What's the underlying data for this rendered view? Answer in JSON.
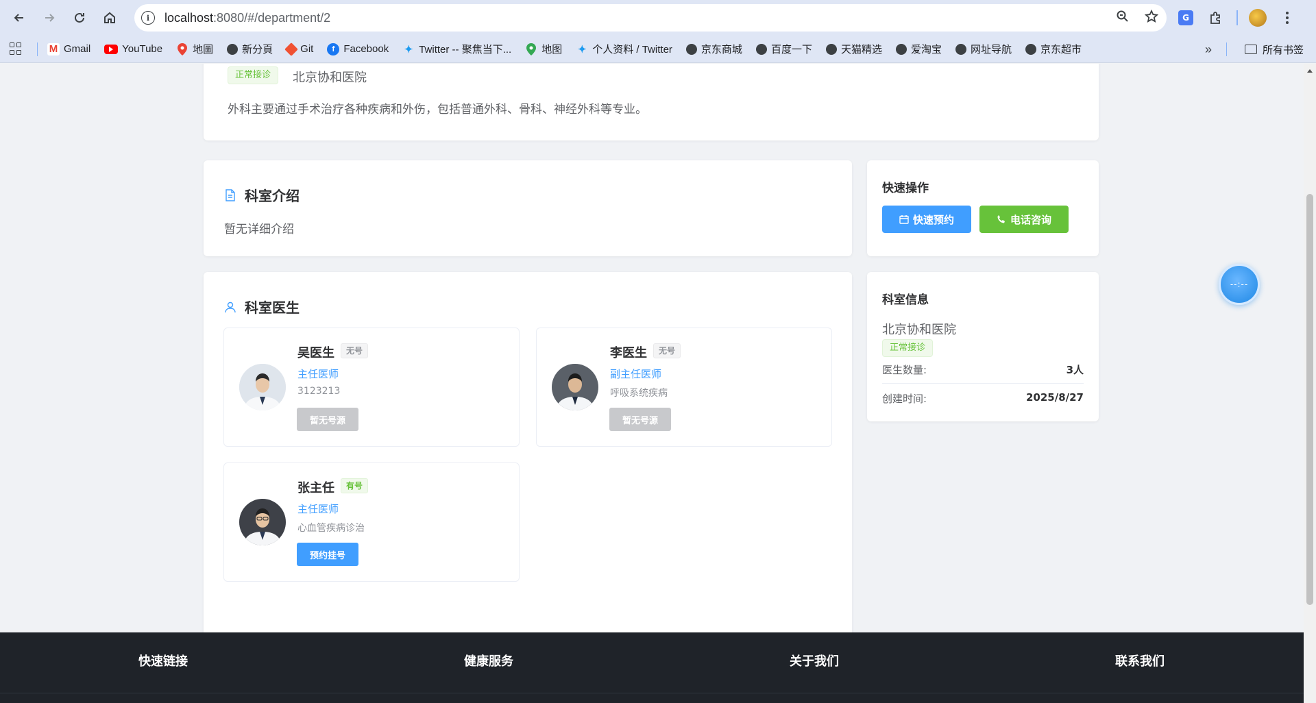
{
  "browser": {
    "url_host": "localhost",
    "url_rest": ":8080/#/department/2"
  },
  "bookmarks": [
    {
      "label": "Gmail",
      "icon": "gmail-icon"
    },
    {
      "label": "YouTube",
      "icon": "youtube-icon"
    },
    {
      "label": "地圖",
      "icon": "maps-icon"
    },
    {
      "label": "新分頁",
      "icon": "globe-icon"
    },
    {
      "label": "Git",
      "icon": "git-icon"
    },
    {
      "label": "Facebook",
      "icon": "facebook-icon"
    },
    {
      "label": "Twitter -- 聚焦当下...",
      "icon": "twitter-icon"
    },
    {
      "label": "地图",
      "icon": "maps-icon"
    },
    {
      "label": "个人资料 / Twitter",
      "icon": "twitter-icon"
    },
    {
      "label": "京东商城",
      "icon": "globe-icon"
    },
    {
      "label": "百度一下",
      "icon": "globe-icon"
    },
    {
      "label": "天猫精选",
      "icon": "globe-icon"
    },
    {
      "label": "爱淘宝",
      "icon": "globe-icon"
    },
    {
      "label": "网址导航",
      "icon": "globe-icon"
    },
    {
      "label": "京东超市",
      "icon": "globe-icon"
    }
  ],
  "bookmarks_folder": "所有书签",
  "department": {
    "status": "正常接诊",
    "hospital": "北京协和医院",
    "description": "外科主要通过手术治疗各种疾病和外伤，包括普通外科、骨科、神经外科等专业。"
  },
  "intro": {
    "title": "科室介绍",
    "text": "暂无详细介绍"
  },
  "quick_actions": {
    "title": "快速操作",
    "book_label": "快速预约",
    "call_label": "电话咨询"
  },
  "doctors_section": {
    "title": "科室医生",
    "doctors": [
      {
        "name": "吴医生",
        "badge": "无号",
        "title": "主任医师",
        "specialty": "3123213",
        "button": "暂无号源"
      },
      {
        "name": "李医生",
        "badge": "无号",
        "title": "副主任医师",
        "specialty": "呼吸系统疾病",
        "button": "暂无号源"
      },
      {
        "name": "张主任",
        "badge": "有号",
        "title": "主任医师",
        "specialty": "心血管疾病诊治",
        "button": "预约挂号"
      }
    ]
  },
  "dept_info": {
    "title": "科室信息",
    "hospital": "北京协和医院",
    "status": "正常接诊",
    "doctor_count_label": "医生数量:",
    "doctor_count_value": "3人",
    "created_label": "创建时间:",
    "created_value": "2025/8/27"
  },
  "floating_widget": "--:--",
  "footer": {
    "col1": "快速链接",
    "col2": "健康服务",
    "col3": "关于我们",
    "col4": "联系我们"
  },
  "colors": {
    "primary": "#409eff",
    "success": "#67c23a",
    "footer_bg": "#1f2329"
  }
}
